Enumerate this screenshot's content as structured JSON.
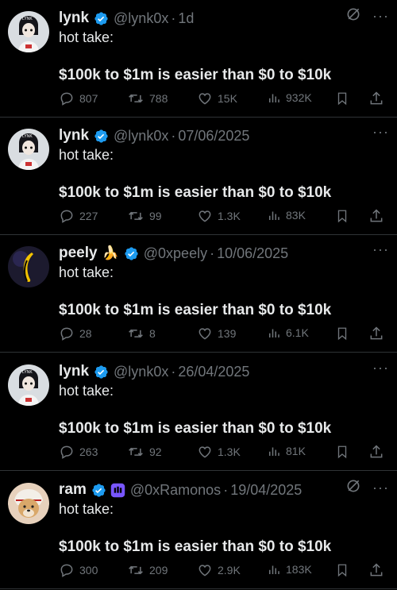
{
  "tweets": [
    {
      "name": "lynk",
      "emoji": "",
      "purple_badge": false,
      "handle": "@lynk0x",
      "date": "1d",
      "grok": true,
      "line1": "hot take:",
      "line2": "$100k to $1m is easier than $0 to $10k",
      "replies": "807",
      "retweets": "788",
      "likes": "15K",
      "views": "932K",
      "avatar": "lynk"
    },
    {
      "name": "lynk",
      "emoji": "",
      "purple_badge": false,
      "handle": "@lynk0x",
      "date": "07/06/2025",
      "grok": false,
      "line1": "hot take:",
      "line2": "$100k to $1m is easier than $0 to $10k",
      "replies": "227",
      "retweets": "99",
      "likes": "1.3K",
      "views": "83K",
      "avatar": "lynk"
    },
    {
      "name": "peely",
      "emoji": "🍌",
      "purple_badge": false,
      "handle": "@0xpeely",
      "date": "10/06/2025",
      "grok": false,
      "line1": "hot take:",
      "line2": "$100k to $1m is easier than $0 to $10k",
      "replies": "28",
      "retweets": "8",
      "likes": "139",
      "views": "6.1K",
      "avatar": "peely"
    },
    {
      "name": "lynk",
      "emoji": "",
      "purple_badge": false,
      "handle": "@lynk0x",
      "date": "26/04/2025",
      "grok": false,
      "line1": "hot take:",
      "line2": "$100k to $1m is easier than $0 to $10k",
      "replies": "263",
      "retweets": "92",
      "likes": "1.3K",
      "views": "81K",
      "avatar": "lynk"
    },
    {
      "name": "ram",
      "emoji": "",
      "purple_badge": true,
      "handle": "@0xRamonos",
      "date": "19/04/2025",
      "grok": true,
      "line1": "hot take:",
      "line2": "$100k to $1m is easier than $0 to $10k",
      "replies": "300",
      "retweets": "209",
      "likes": "2.9K",
      "views": "183K",
      "avatar": "ram"
    }
  ],
  "colors": {
    "background": "#000000",
    "text": "#e7e9ea",
    "muted": "#71767b",
    "verified": "#1d9bf0",
    "divider": "#2f3336",
    "purple": "#7856ff"
  }
}
